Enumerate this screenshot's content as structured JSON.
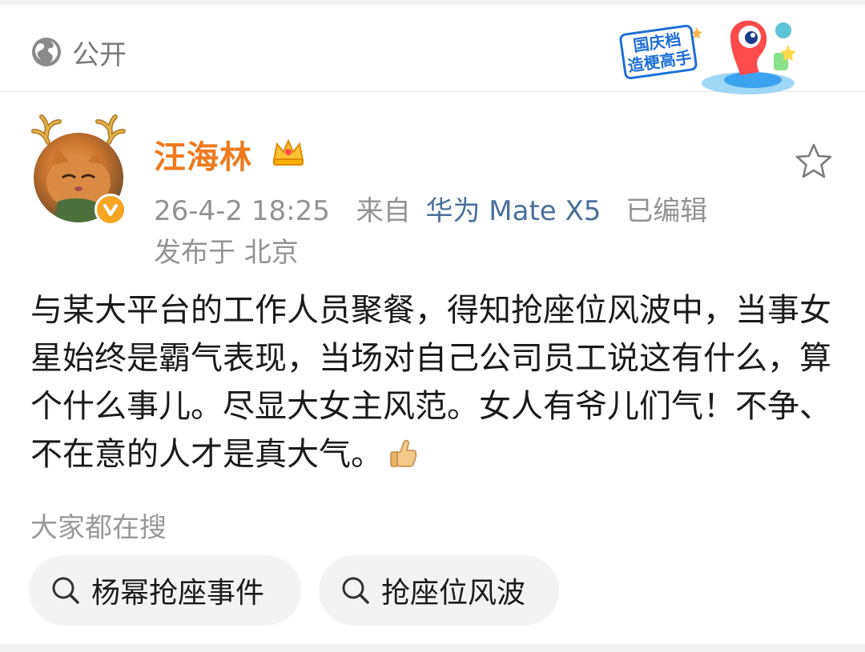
{
  "header": {
    "visibility_label": "公开",
    "visibility_icon": "globe-icon",
    "promo_line1": "国庆档",
    "promo_line2": "造梗高手"
  },
  "post": {
    "author": "汪海林",
    "author_color": "#f07a1f",
    "timestamp": "26-4-2 18:25",
    "source_prefix": "来自",
    "device": "华为 Mate X5",
    "edited": "已编辑",
    "location": "发布于 北京",
    "text": "与某大平台的工作人员聚餐，得知抢座位风波中，当事女星始终是霸气表现，当场对自己公司员工说这有什么，算个什么事儿。尽显大女主风范。女人有爷儿们气！不争、不在意的人才是真大气。"
  },
  "search": {
    "label": "大家都在搜",
    "chips": [
      {
        "label": "杨幂抢座事件"
      },
      {
        "label": "抢座位风波"
      }
    ]
  }
}
